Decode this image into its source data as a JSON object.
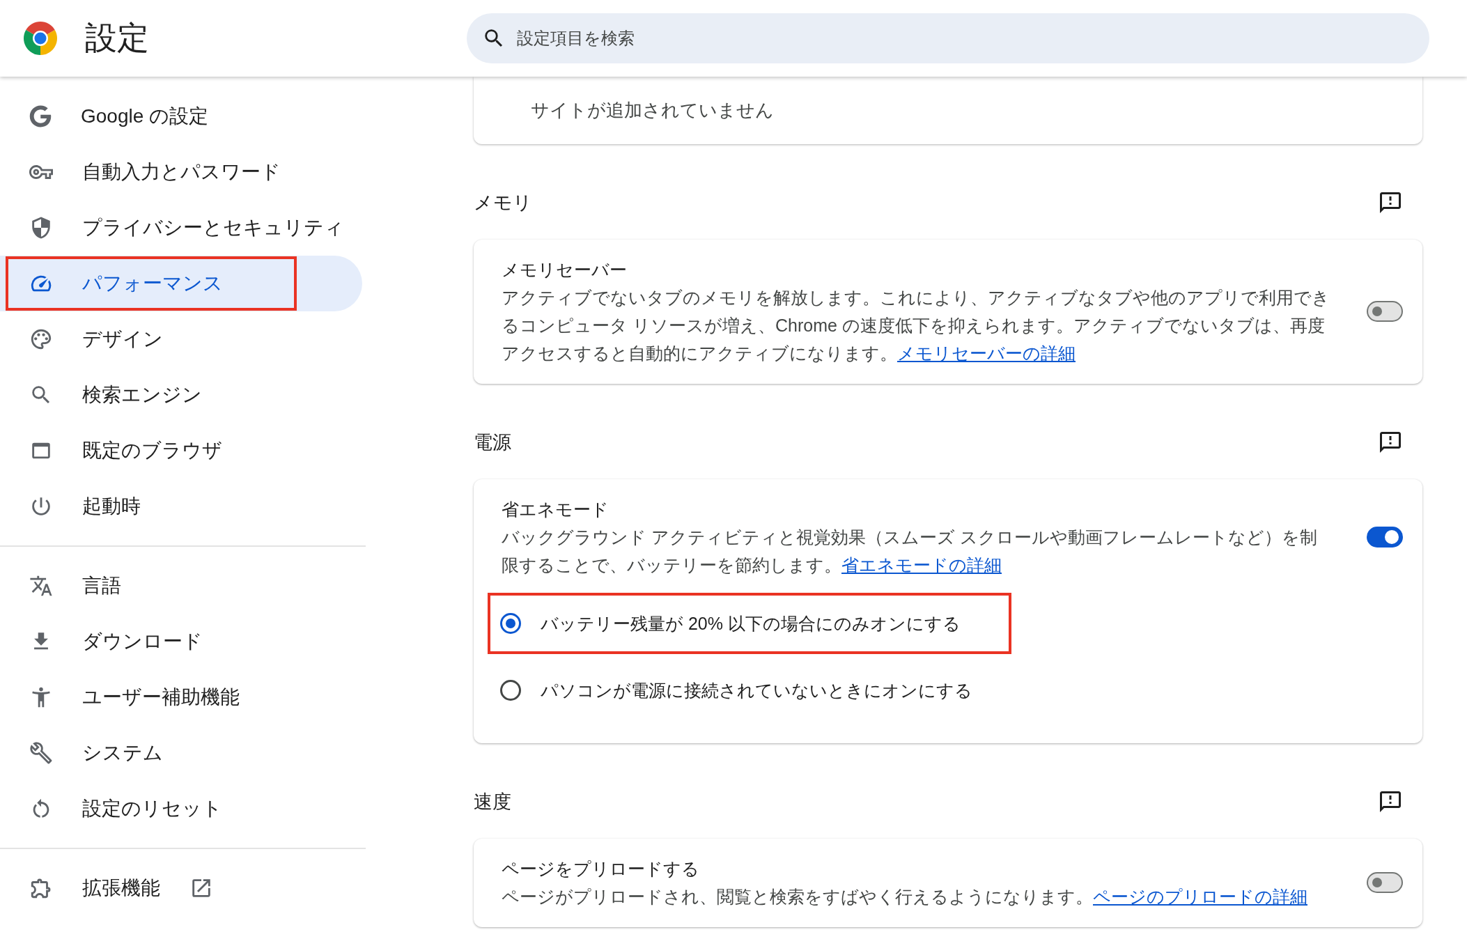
{
  "header": {
    "title": "設定",
    "search": {
      "placeholder": "設定項目を検索"
    }
  },
  "sidebar": {
    "groups": [
      {
        "items": [
          {
            "label": "Google の設定",
            "selected": false,
            "highlighted": false,
            "external": false
          },
          {
            "label": "自動入力とパスワード",
            "selected": false,
            "highlighted": false,
            "external": false
          },
          {
            "label": "プライバシーとセキュリティ",
            "selected": false,
            "highlighted": false,
            "external": false
          },
          {
            "label": "パフォーマンス",
            "selected": true,
            "highlighted": true,
            "external": false
          },
          {
            "label": "デザイン",
            "selected": false,
            "highlighted": false,
            "external": false
          },
          {
            "label": "検索エンジン",
            "selected": false,
            "highlighted": false,
            "external": false
          },
          {
            "label": "既定のブラウザ",
            "selected": false,
            "highlighted": false,
            "external": false
          },
          {
            "label": "起動時",
            "selected": false,
            "highlighted": false,
            "external": false
          }
        ]
      },
      {
        "items": [
          {
            "label": "言語",
            "selected": false,
            "highlighted": false,
            "external": false
          },
          {
            "label": "ダウンロード",
            "selected": false,
            "highlighted": false,
            "external": false
          },
          {
            "label": "ユーザー補助機能",
            "selected": false,
            "highlighted": false,
            "external": false
          },
          {
            "label": "システム",
            "selected": false,
            "highlighted": false,
            "external": false
          },
          {
            "label": "設定のリセット",
            "selected": false,
            "highlighted": false,
            "external": false
          }
        ]
      },
      {
        "items": [
          {
            "label": "拡張機能",
            "selected": false,
            "highlighted": false,
            "external": true
          }
        ]
      }
    ]
  },
  "main": {
    "top_card": {
      "text": "サイトが追加されていません"
    },
    "sections": [
      {
        "heading": "メモリ",
        "card": {
          "title": "メモリセーバー",
          "description": "アクティブでないタブのメモリを解放します。これにより、アクティブなタブや他のアプリで利用できるコンピュータ リソースが増え、Chrome の速度低下を抑えられます。アクティブでないタブは、再度アクセスすると自動的にアクティブになります。",
          "link": "メモリセーバーの詳細",
          "toggle": {
            "on": false
          }
        }
      },
      {
        "heading": "電源",
        "card": {
          "title": "省エネモード",
          "description": "バックグラウンド アクティビティと視覚効果（スムーズ スクロールや動画フレームレートなど）を制限することで、バッテリーを節約します。",
          "link": "省エネモードの詳細",
          "toggle": {
            "on": true
          },
          "options": [
            {
              "label": "バッテリー残量が 20% 以下の場合にのみオンにする",
              "selected": true,
              "highlighted": true
            },
            {
              "label": "パソコンが電源に接続されていないときにオンにする",
              "selected": false,
              "highlighted": false
            }
          ]
        }
      },
      {
        "heading": "速度",
        "card": {
          "title": "ページをプリロードする",
          "description": "ページがプリロードされ、閲覧と検索をすばやく行えるようになります。",
          "link": "ページのプリロードの詳細",
          "toggle": {
            "on": false
          }
        }
      }
    ]
  }
}
